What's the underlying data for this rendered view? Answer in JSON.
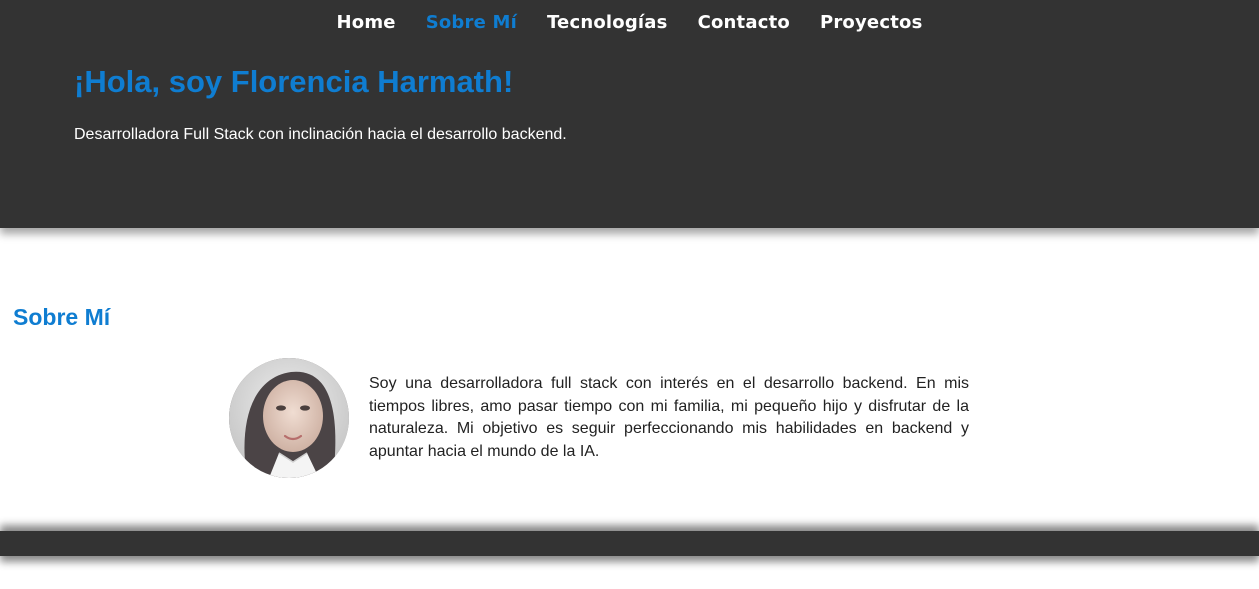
{
  "nav": {
    "items": [
      {
        "label": "Home"
      },
      {
        "label": "Sobre Mí"
      },
      {
        "label": "Tecnologías"
      },
      {
        "label": "Contacto"
      },
      {
        "label": "Proyectos"
      }
    ],
    "active_index": 1
  },
  "hero": {
    "title": "¡Hola, soy Florencia Harmath!",
    "subtitle": "Desarrolladora Full Stack con inclinación hacia el desarrollo backend."
  },
  "about": {
    "heading": "Sobre Mí",
    "text": "Soy una desarrolladora full stack con interés en el desarrollo backend. En mis tiempos libres, amo pasar tiempo con mi familia, mi pequeño hijo y disfrutar de la naturaleza. Mi objetivo es seguir perfeccionando mis habilidades en backend y apuntar hacia el mundo de la IA."
  },
  "colors": {
    "accent": "#0f7dd1",
    "header_bg": "#333333",
    "text_light": "#ffffff",
    "text_dark": "#222222"
  }
}
